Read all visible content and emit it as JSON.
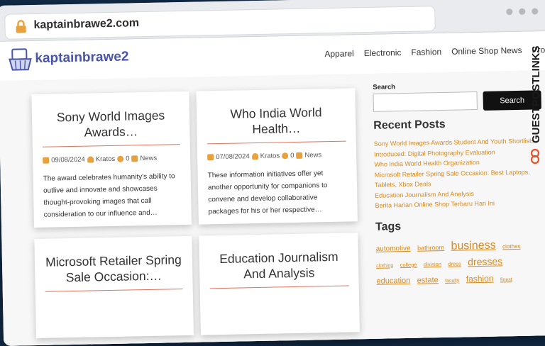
{
  "browser": {
    "url": "kaptainbrawe2.com"
  },
  "site": {
    "brand": "kaptainbrawe2",
    "nav": [
      "Apparel",
      "Electronic",
      "Fashion",
      "Online Shop News",
      "Promo"
    ]
  },
  "posts": [
    {
      "title": "Sony World Images Awards…",
      "date": "09/08/2024",
      "author": "Kratos",
      "comments": "0",
      "category": "News",
      "excerpt": "The award celebrates humanity's ability to outlive and innovate and showcases thought-provoking images that call consideration to our influence and…"
    },
    {
      "title": "Who India World Health…",
      "date": "07/08/2024",
      "author": "Kratos",
      "comments": "0",
      "category": "News",
      "excerpt": "These information initiatives offer yet another opportunity for companions to convene and develop collaborative packages for his or her respective…"
    },
    {
      "title": "Microsoft Retailer Spring Sale Occasion:…"
    },
    {
      "title": "Education Journalism And Analysis"
    }
  ],
  "sidebar": {
    "search_label": "Search",
    "search_button": "Search",
    "recent_title": "Recent Posts",
    "recent_posts": [
      "Sony World Images Awards Student And Youth Shortlists Introduced: Digital Photography Evaluation",
      "Who India World Health Organization",
      "Microsoft Retailer Spring Sale Occasion: Best Laptops, Tablets, Xbox Deals",
      "Education Journalism And Analysis",
      "Berita Harian Online Shop Terbaru Hari Ini"
    ],
    "tags_title": "Tags",
    "tags": [
      "automotive",
      "bathroom",
      "business",
      "clothes",
      "clothing",
      "college",
      "division",
      "dress",
      "dresses",
      "education",
      "estate",
      "faculty",
      "fashion",
      "finest"
    ]
  },
  "watermark": "GUESTPOSTLINKS",
  "colors": {
    "accent": "#d88a1c",
    "brand": "#4a55a8",
    "rule": "#e0735f",
    "background": "#122a46"
  }
}
